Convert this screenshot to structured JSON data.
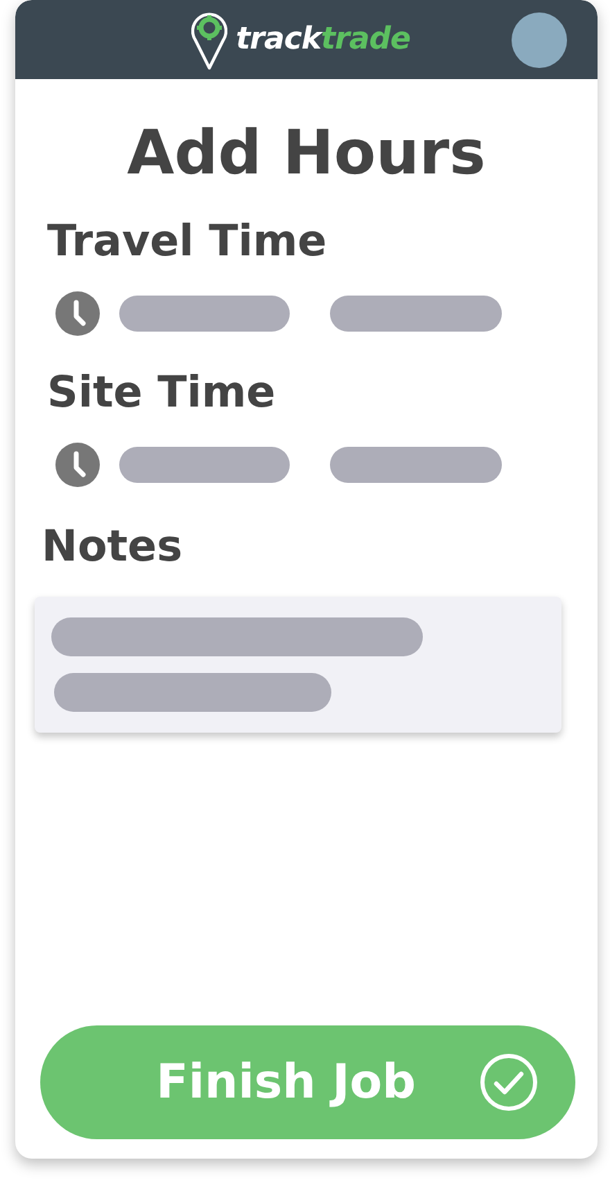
{
  "header": {
    "logo": {
      "part_1": "track",
      "part_2": "trade"
    }
  },
  "title": "Add Hours",
  "sections": [
    {
      "label": "Travel Time",
      "kind": "time"
    },
    {
      "label": "Site Time",
      "kind": "time"
    },
    {
      "label": "Notes",
      "kind": "notes"
    }
  ],
  "finish_button": {
    "label": "Finish Job"
  }
}
